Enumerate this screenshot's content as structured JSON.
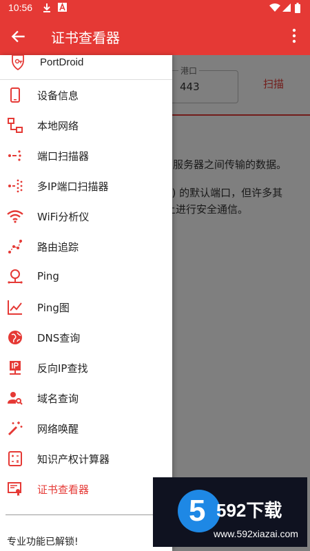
{
  "status_bar": {
    "time": "10:56"
  },
  "app_bar": {
    "title": "证书查看器"
  },
  "main": {
    "port_label": "港口",
    "port_value": "443",
    "scan_label": "扫描",
    "desc_line1": "服务器之间传输的数据。",
    "desc_line2": "S) 的默认端口，但许多其",
    "desc_line3": "上进行安全通信。"
  },
  "drawer": {
    "app_name": "PortDroid",
    "items": [
      {
        "label": "设备信息",
        "icon": "phone-icon"
      },
      {
        "label": "本地网络",
        "icon": "network-icon"
      },
      {
        "label": "端口扫描器",
        "icon": "port-scan-icon"
      },
      {
        "label": "多IP端口扫描器",
        "icon": "multi-port-scan-icon"
      },
      {
        "label": "WiFi分析仪",
        "icon": "wifi-icon"
      },
      {
        "label": "路由追踪",
        "icon": "route-icon"
      },
      {
        "label": "Ping",
        "icon": "ping-icon"
      },
      {
        "label": "Ping图",
        "icon": "chart-icon"
      },
      {
        "label": "DNS查询",
        "icon": "globe-icon"
      },
      {
        "label": "反向IP查找",
        "icon": "ip-icon"
      },
      {
        "label": "域名查询",
        "icon": "person-search-icon"
      },
      {
        "label": "网络唤醒",
        "icon": "wand-icon"
      },
      {
        "label": "知识产权计算器",
        "icon": "calculator-icon"
      },
      {
        "label": "证书查看器",
        "icon": "certificate-icon",
        "active": true
      }
    ],
    "pro_text": "专业功能已解锁!"
  },
  "watermark": {
    "logo_digit": "5",
    "brand": "592下载",
    "url": "www.592xiazai.com"
  },
  "colors": {
    "primary": "#e53935",
    "overlay": "rgba(0,0,0,0.5)",
    "watermark_bg": "#0f1220"
  }
}
